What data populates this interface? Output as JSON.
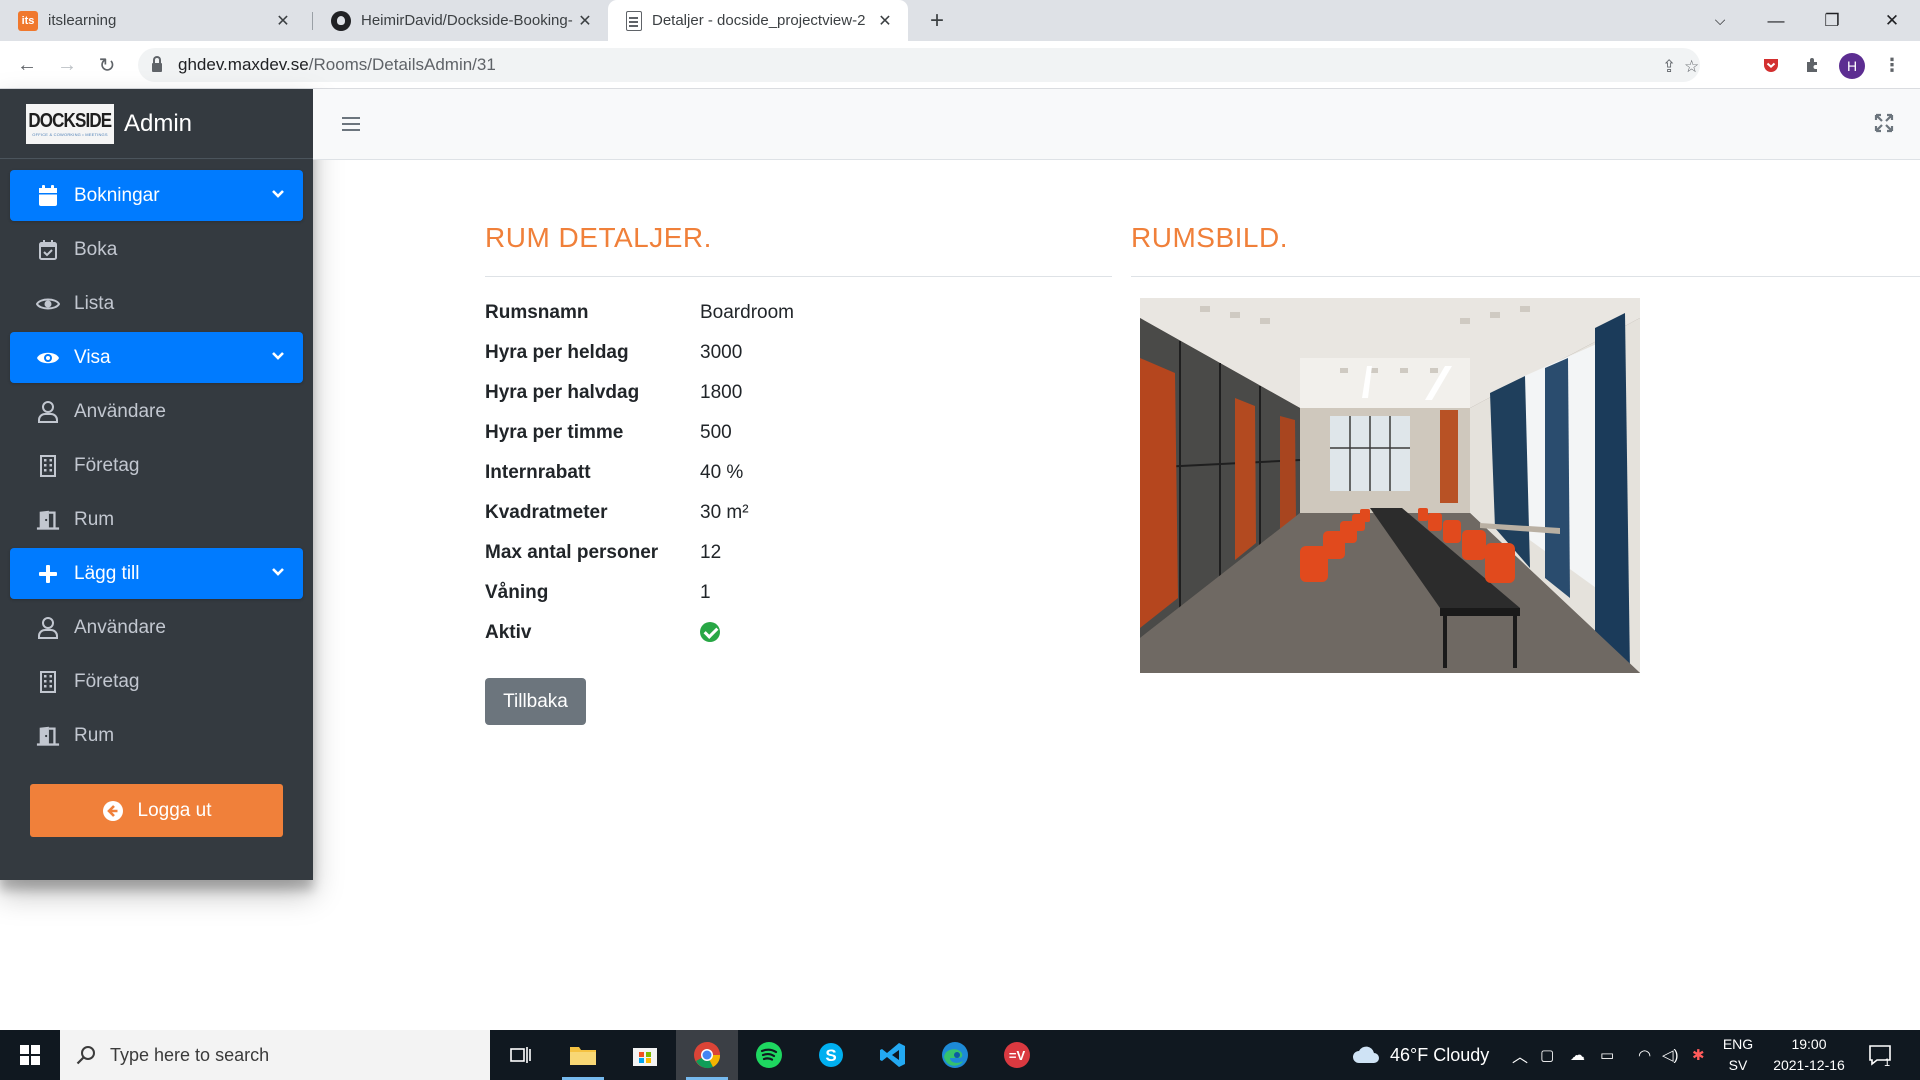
{
  "browser": {
    "tabs": [
      {
        "title": "itslearning",
        "favicon": "its",
        "active": false
      },
      {
        "title": "HeimirDavid/Dockside-Booking-I",
        "favicon": "github",
        "active": false
      },
      {
        "title": "Detaljer - docside_projectview-2",
        "favicon": "doc",
        "active": true
      }
    ],
    "url_host": "ghdev.maxdev.se",
    "url_path": "/Rooms/DetailsAdmin/31",
    "profile_initial": "H"
  },
  "sidebar": {
    "brand": {
      "logo_text": "DOCKSIDE",
      "logo_sub": "OFFICE & COWORKING • MEETINGS",
      "title": "Admin"
    },
    "items": [
      {
        "label": "Bokningar",
        "icon": "calendar-icon",
        "header": true
      },
      {
        "label": "Boka",
        "icon": "calendar-check-icon",
        "header": false
      },
      {
        "label": "Lista",
        "icon": "eye-icon",
        "header": false
      },
      {
        "label": "Visa",
        "icon": "eye-icon",
        "header": true
      },
      {
        "label": "Användare",
        "icon": "user-icon",
        "header": false
      },
      {
        "label": "Företag",
        "icon": "building-icon",
        "header": false
      },
      {
        "label": "Rum",
        "icon": "door-icon",
        "header": false
      },
      {
        "label": "Lägg till",
        "icon": "plus-icon",
        "header": true
      },
      {
        "label": "Användare",
        "icon": "user-icon",
        "header": false
      },
      {
        "label": "Företag",
        "icon": "building-icon",
        "header": false
      },
      {
        "label": "Rum",
        "icon": "door-icon",
        "header": false
      }
    ],
    "logout_label": "Logga ut"
  },
  "main": {
    "details_title": "RUM DETALJER.",
    "image_title": "RUMSBILD.",
    "details": [
      {
        "label": "Rumsnamn",
        "value": "Boardroom"
      },
      {
        "label": "Hyra per heldag",
        "value": "3000"
      },
      {
        "label": "Hyra per halvdag",
        "value": "1800"
      },
      {
        "label": "Hyra per timme",
        "value": "500"
      },
      {
        "label": "Internrabatt",
        "value": "40 %"
      },
      {
        "label": "Kvadratmeter",
        "value": "30 m²"
      },
      {
        "label": "Max antal personer",
        "value": "12"
      },
      {
        "label": "Våning",
        "value": "1"
      },
      {
        "label": "Aktiv",
        "value": ""
      }
    ],
    "aktiv_status": "check-circle-icon",
    "back_button": "Tillbaka"
  },
  "taskbar": {
    "search_placeholder": "Type here to search",
    "weather": "46°F  Cloudy",
    "lang_top": "ENG",
    "lang_bottom": "SV",
    "time": "19:00",
    "date": "2021-12-16",
    "notification_count": "1"
  },
  "colors": {
    "accent_orange": "#f0803a",
    "primary_blue": "#007bff",
    "sidebar_bg": "#343a40",
    "success_green": "#28a745",
    "secondary_gray": "#6c757d"
  }
}
